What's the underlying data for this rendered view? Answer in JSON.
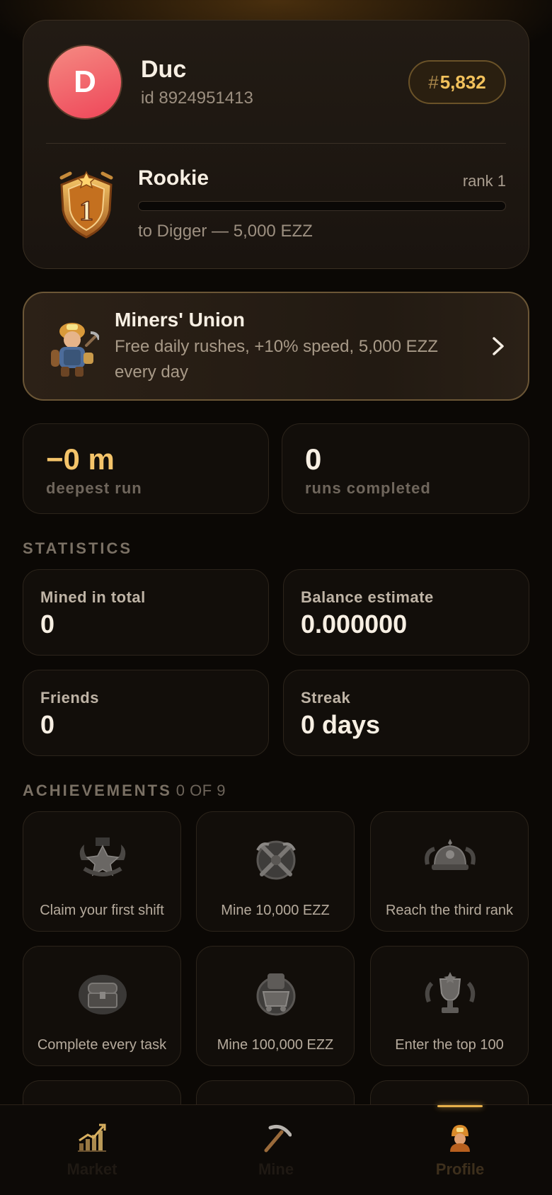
{
  "profile": {
    "avatar_letter": "D",
    "name": "Duc",
    "id_text": "id 8924951413",
    "leaderboard_hash": "#",
    "leaderboard_rank": "5,832",
    "level_name": "Rookie",
    "level_rank": "rank 1",
    "level_progress": 0,
    "next_level": "to Digger — 5,000 EZZ"
  },
  "union": {
    "title": "Miners' Union",
    "description": "Free daily rushes, +10% speed, 5,000 EZZ every day"
  },
  "highlights": {
    "deepest_value": "−0 m",
    "deepest_label": "deepest run",
    "runs_value": "0",
    "runs_label": "runs completed"
  },
  "statistics": {
    "title": "STATISTICS",
    "mined_label": "Mined in total",
    "mined_value": "0",
    "balance_label": "Balance estimate",
    "balance_value": "0.000000",
    "friends_label": "Friends",
    "friends_value": "0",
    "streak_label": "Streak",
    "streak_value": "0 days"
  },
  "achievements": {
    "title": "ACHIEVEMENTS",
    "count": "0 OF 9",
    "items": [
      {
        "label": "Claim your first shift"
      },
      {
        "label": "Mine 10,000 EZZ"
      },
      {
        "label": "Reach the third rank"
      },
      {
        "label": "Complete every task"
      },
      {
        "label": "Mine 100,000 EZZ"
      },
      {
        "label": "Enter the top 100"
      }
    ]
  },
  "nav": {
    "market": "Market",
    "mine": "Mine",
    "profile": "Profile",
    "active": "Profile"
  },
  "colors": {
    "accent_gold": "#f3c25c",
    "avatar_gradient": "#ee4659",
    "deepest_value": "#f4c46a"
  }
}
